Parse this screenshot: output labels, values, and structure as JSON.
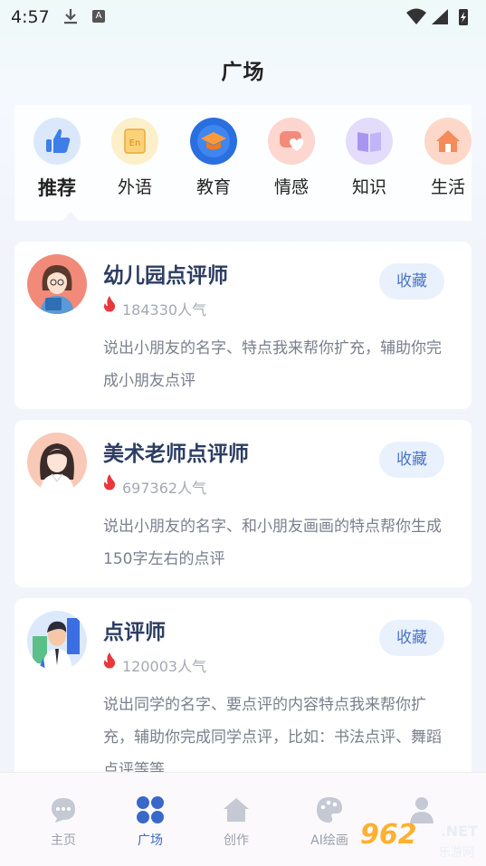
{
  "status_bar": {
    "time": "4:57",
    "icons": [
      "download-icon",
      "a-icon",
      "wifi-icon",
      "signal-icon",
      "battery-icon"
    ]
  },
  "page": {
    "title": "广场"
  },
  "categories": [
    {
      "label": "推荐",
      "icon": "thumbs-up-icon",
      "active": true
    },
    {
      "label": "外语",
      "icon": "en-book-icon"
    },
    {
      "label": "教育",
      "icon": "graduation-cap-icon"
    },
    {
      "label": "情感",
      "icon": "heart-chat-icon"
    },
    {
      "label": "知识",
      "icon": "open-book-icon"
    },
    {
      "label": "生活",
      "icon": "home-icon"
    }
  ],
  "cards": [
    {
      "title": "幼儿园点评师",
      "popularity": "184330人气",
      "description": "说出小朋友的名字、特点我来帮你扩充，辅助你完成小朋友点评",
      "button": "收藏"
    },
    {
      "title": "美术老师点评师",
      "popularity": "697362人气",
      "description": "说出小朋友的名字、和小朋友画画的特点帮你生成150字左右的点评",
      "button": "收藏"
    },
    {
      "title": "点评师",
      "popularity": "120003人气",
      "description": "说出同学的名字、要点评的内容特点我来帮你扩充，辅助你完成同学点评，比如：书法点评、舞蹈点评等等",
      "button": "收藏"
    }
  ],
  "bottom_nav": [
    {
      "label": "主页",
      "icon": "chat-bubble-icon"
    },
    {
      "label": "广场",
      "icon": "grid-icon",
      "active": true
    },
    {
      "label": "创作",
      "icon": "home-icon"
    },
    {
      "label": "AI绘画",
      "icon": "palette-icon"
    },
    {
      "label": "",
      "icon": "user-icon"
    }
  ],
  "watermark": {
    "logo": "962",
    "domain": ".NET",
    "sub": "乐游网"
  },
  "colors": {
    "accent": "#3a68c9",
    "title": "#2d3d63",
    "fire": "#e8383d",
    "button_bg": "#e9f1fd"
  }
}
